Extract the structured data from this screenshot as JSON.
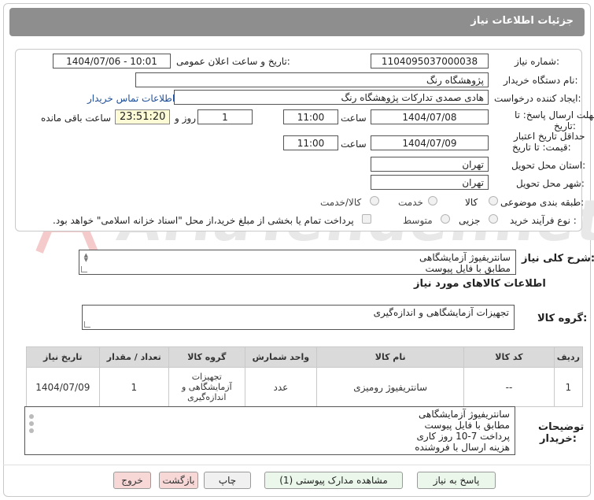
{
  "header": {
    "title": "جزئیات اطلاعات نیاز"
  },
  "form": {
    "need_number_label": "شماره نیاز:",
    "need_number": "1104095037000038",
    "announce_label": "تاریخ و ساعت اعلان عمومی:",
    "announce_value": "1404/07/06 - 10:01",
    "buyer_org_label": "نام دستگاه خریدار:",
    "buyer_org": "پژوهشگاه رنگ",
    "requester_label": "ایجاد کننده درخواست:",
    "requester": "هادی صمدی تدارکات پژوهشگاه رنگ",
    "contact_link": "اطلاعات تماس خریدار",
    "deadline_label_line1": "مهلت ارسال پاسخ: تا",
    "deadline_label_line2": "تاریخ:",
    "deadline_date": "1404/07/08",
    "time_label": "ساعت",
    "deadline_time": "11:00",
    "days_value": "1",
    "days_label": "روز و",
    "remaining_time": "23:51:20",
    "remaining_label": "ساعت باقی مانده",
    "validity_label_line1": "حداقل تاریخ اعتبار",
    "validity_label_line2": "قیمت: تا تاریخ:",
    "validity_date": "1404/07/09",
    "validity_time": "11:00",
    "province_label": "استان محل تحویل:",
    "province": "تهران",
    "city_label": "شهر محل تحویل:",
    "city": "تهران",
    "category_label": "طبقه بندی موضوعی:",
    "category_options": [
      "کالا",
      "خدمت",
      "کالا/خدمت"
    ],
    "process_label": "نوع فرآیند خرید :",
    "process_options": [
      "جزیی",
      "متوسط"
    ],
    "payment_note": "پرداخت تمام یا بخشی از مبلغ خرید،از محل \"اسناد خزانه اسلامی\" خواهد بود."
  },
  "description": {
    "label": "شرح کلی نیاز:",
    "lines": [
      "سانتریفیوژ آزمایشگاهی",
      "مطابق با فایل پیوست"
    ]
  },
  "goods_section": {
    "title": "اطلاعات کالاهای مورد نیاز",
    "group_label": "گروه کالا:",
    "group_value": "تجهیزات آزمایشگاهی و اندازه‌گیری"
  },
  "table": {
    "headers": [
      "ردیف",
      "کد کالا",
      "نام کالا",
      "واحد شمارش",
      "گروه کالا",
      "تعداد / مقدار",
      "تاریخ نیاز"
    ],
    "rows": [
      {
        "row": "1",
        "code": "--",
        "name": "سانتریفیوژ رومیزی",
        "unit": "عدد",
        "group": "تجهیزات آزمایشگاهی و اندازه‌گیری",
        "qty": "1",
        "date": "1404/07/09"
      }
    ]
  },
  "buyer_notes": {
    "label_line1": "توضیحات",
    "label_line2": "خریدار:",
    "lines": [
      "سانتریفیوژ آزمایشگاهی",
      "مطابق با فایل پیوست",
      "پرداخت 7-10 روز کاری",
      "هزینه ارسال با فروشنده"
    ]
  },
  "buttons": {
    "reply": "پاسخ به نیاز",
    "attachments": "مشاهده مدارک پیوستی (1)",
    "print": "چاپ",
    "back": "بازگشت",
    "exit": "خروج"
  },
  "watermark": {
    "text": "AriaTender.net"
  }
}
